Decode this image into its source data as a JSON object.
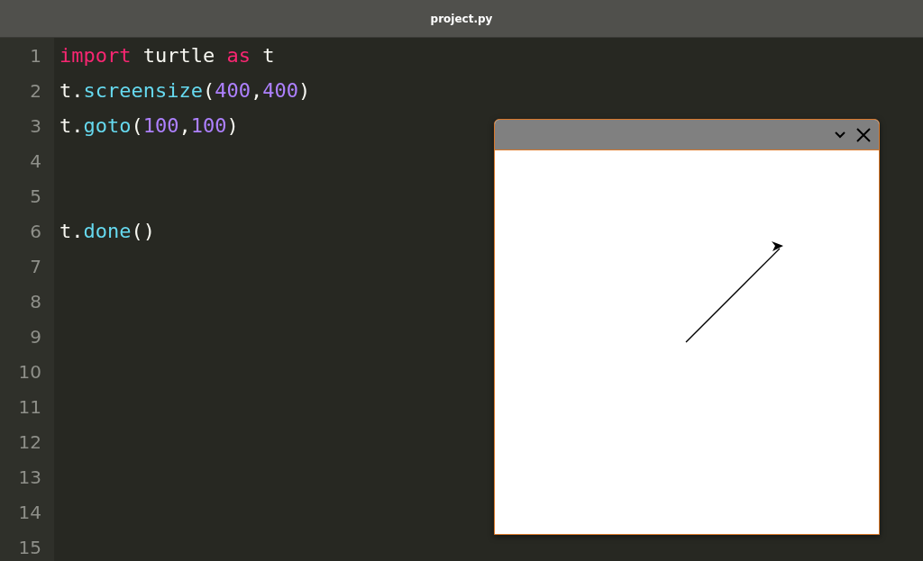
{
  "window": {
    "title": "project.py"
  },
  "editor": {
    "lines": [
      {
        "number": "1",
        "tokens": [
          {
            "text": "import",
            "kind": "keyword"
          },
          {
            "text": " turtle ",
            "kind": "plain"
          },
          {
            "text": "as",
            "kind": "keyword"
          },
          {
            "text": " t",
            "kind": "plain"
          }
        ]
      },
      {
        "number": "2",
        "tokens": [
          {
            "text": "t.",
            "kind": "plain"
          },
          {
            "text": "screensize",
            "kind": "function"
          },
          {
            "text": "(",
            "kind": "plain"
          },
          {
            "text": "400",
            "kind": "number"
          },
          {
            "text": ",",
            "kind": "plain"
          },
          {
            "text": "400",
            "kind": "number"
          },
          {
            "text": ")",
            "kind": "plain"
          }
        ]
      },
      {
        "number": "3",
        "tokens": [
          {
            "text": "t.",
            "kind": "plain"
          },
          {
            "text": "goto",
            "kind": "function"
          },
          {
            "text": "(",
            "kind": "plain"
          },
          {
            "text": "100",
            "kind": "number"
          },
          {
            "text": ",",
            "kind": "plain"
          },
          {
            "text": "100",
            "kind": "number"
          },
          {
            "text": ")",
            "kind": "plain"
          }
        ]
      },
      {
        "number": "4"
      },
      {
        "number": "5"
      },
      {
        "number": "6",
        "tokens": [
          {
            "text": "t.",
            "kind": "plain"
          },
          {
            "text": "done",
            "kind": "function"
          },
          {
            "text": "()",
            "kind": "plain"
          }
        ]
      },
      {
        "number": "7"
      },
      {
        "number": "8"
      },
      {
        "number": "9"
      },
      {
        "number": "10"
      },
      {
        "number": "11"
      },
      {
        "number": "12"
      },
      {
        "number": "13"
      },
      {
        "number": "14"
      },
      {
        "number": "15"
      }
    ]
  }
}
